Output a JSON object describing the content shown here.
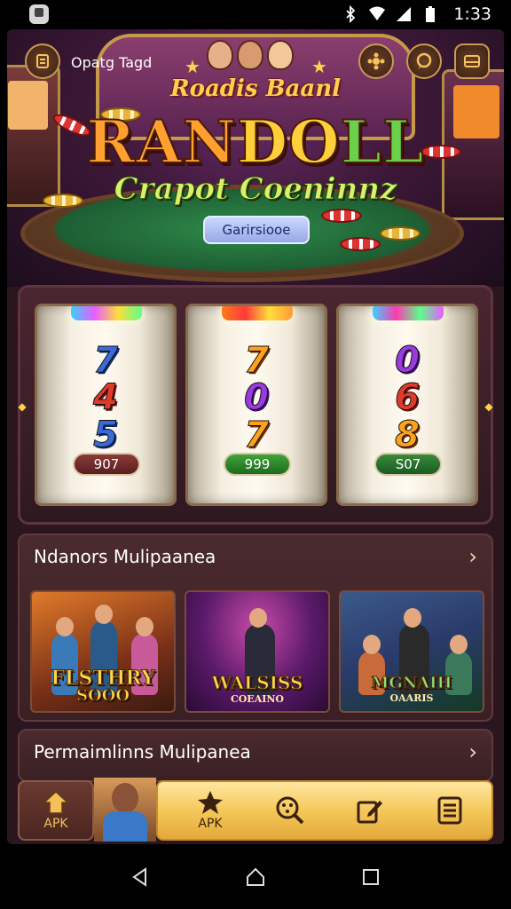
{
  "status_bar": {
    "time": "1:33",
    "icons": [
      "bluetooth-icon",
      "wifi-icon",
      "signal-icon",
      "battery-icon"
    ]
  },
  "hero": {
    "user_name": "Opatg Tagd",
    "top_buttons": [
      "menu-icon",
      "settings-icon",
      "chat-icon",
      "inbox-icon"
    ],
    "subtitle": "Roadis Baanl",
    "title_parts": [
      "RAN",
      "DO",
      "LL"
    ],
    "tagline": "Crapot Coeninnz",
    "pill_label": "Garirsiooe"
  },
  "reels": [
    {
      "symbols": [
        "7",
        "4",
        "5"
      ],
      "colors": [
        "blue",
        "red",
        "blue"
      ],
      "score": "907",
      "score_color": "brown"
    },
    {
      "symbols": [
        "7",
        "0",
        "7"
      ],
      "colors": [
        "orange",
        "purple",
        "orange"
      ],
      "score": "999",
      "score_color": "green"
    },
    {
      "symbols": [
        "0",
        "6",
        "8"
      ],
      "colors": [
        "purple",
        "red",
        "orange"
      ],
      "score": "S07",
      "score_color": "darkgreen"
    }
  ],
  "section1": {
    "title": "Ndanors Mulipaanea",
    "cards": [
      {
        "title": "FLSTHRY",
        "subtitle": "SOOO"
      },
      {
        "title": "WALSISS",
        "subtitle": "COEAINO"
      },
      {
        "title": "MGNAIH",
        "subtitle": "OAARIS"
      }
    ]
  },
  "section2": {
    "title": "Permaimlinns Mulipanea"
  },
  "bottom_nav": {
    "home_label": "APK",
    "items": [
      {
        "icon": "star-icon",
        "label": "APK"
      },
      {
        "icon": "search-icon",
        "label": ""
      },
      {
        "icon": "edit-icon",
        "label": ""
      },
      {
        "icon": "list-icon",
        "label": ""
      }
    ]
  },
  "colors": {
    "background": "#2b1620",
    "gold": "#ffd04a",
    "nav_bar": "#f5c85a"
  }
}
